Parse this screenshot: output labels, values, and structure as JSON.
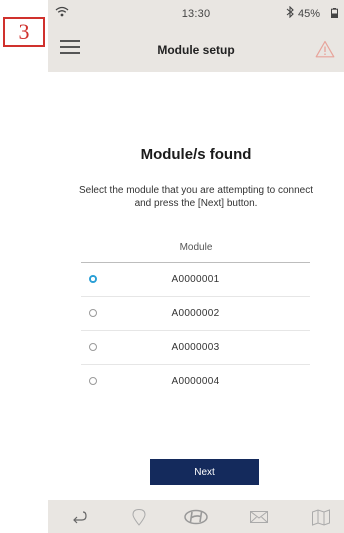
{
  "step_badge": "3",
  "status_bar": {
    "time": "13:30",
    "battery": "45%"
  },
  "header": {
    "title": "Module setup",
    "menu_icon": "hamburger-menu-icon",
    "alert_icon": "warning-triangle-icon"
  },
  "main": {
    "heading": "Module/s found",
    "instruction": "Select the module that you are attempting to connect and press the [Next] button.",
    "column_header": "Module",
    "modules": [
      {
        "label": "A0000001",
        "selected": true
      },
      {
        "label": "A0000002",
        "selected": false
      },
      {
        "label": "A0000003",
        "selected": false
      },
      {
        "label": "A0000004",
        "selected": false
      }
    ],
    "next_label": "Next"
  },
  "tab_bar": {
    "icons": [
      "back-arrow-icon",
      "location-pin-icon",
      "hyundai-logo-icon",
      "mail-icon",
      "map-icon"
    ]
  },
  "colors": {
    "accent": "#2a9fd6",
    "button": "#142a5c",
    "bar_background": "#e9e6e2",
    "warning": "#e8a39a",
    "badge": "#d0312d"
  }
}
